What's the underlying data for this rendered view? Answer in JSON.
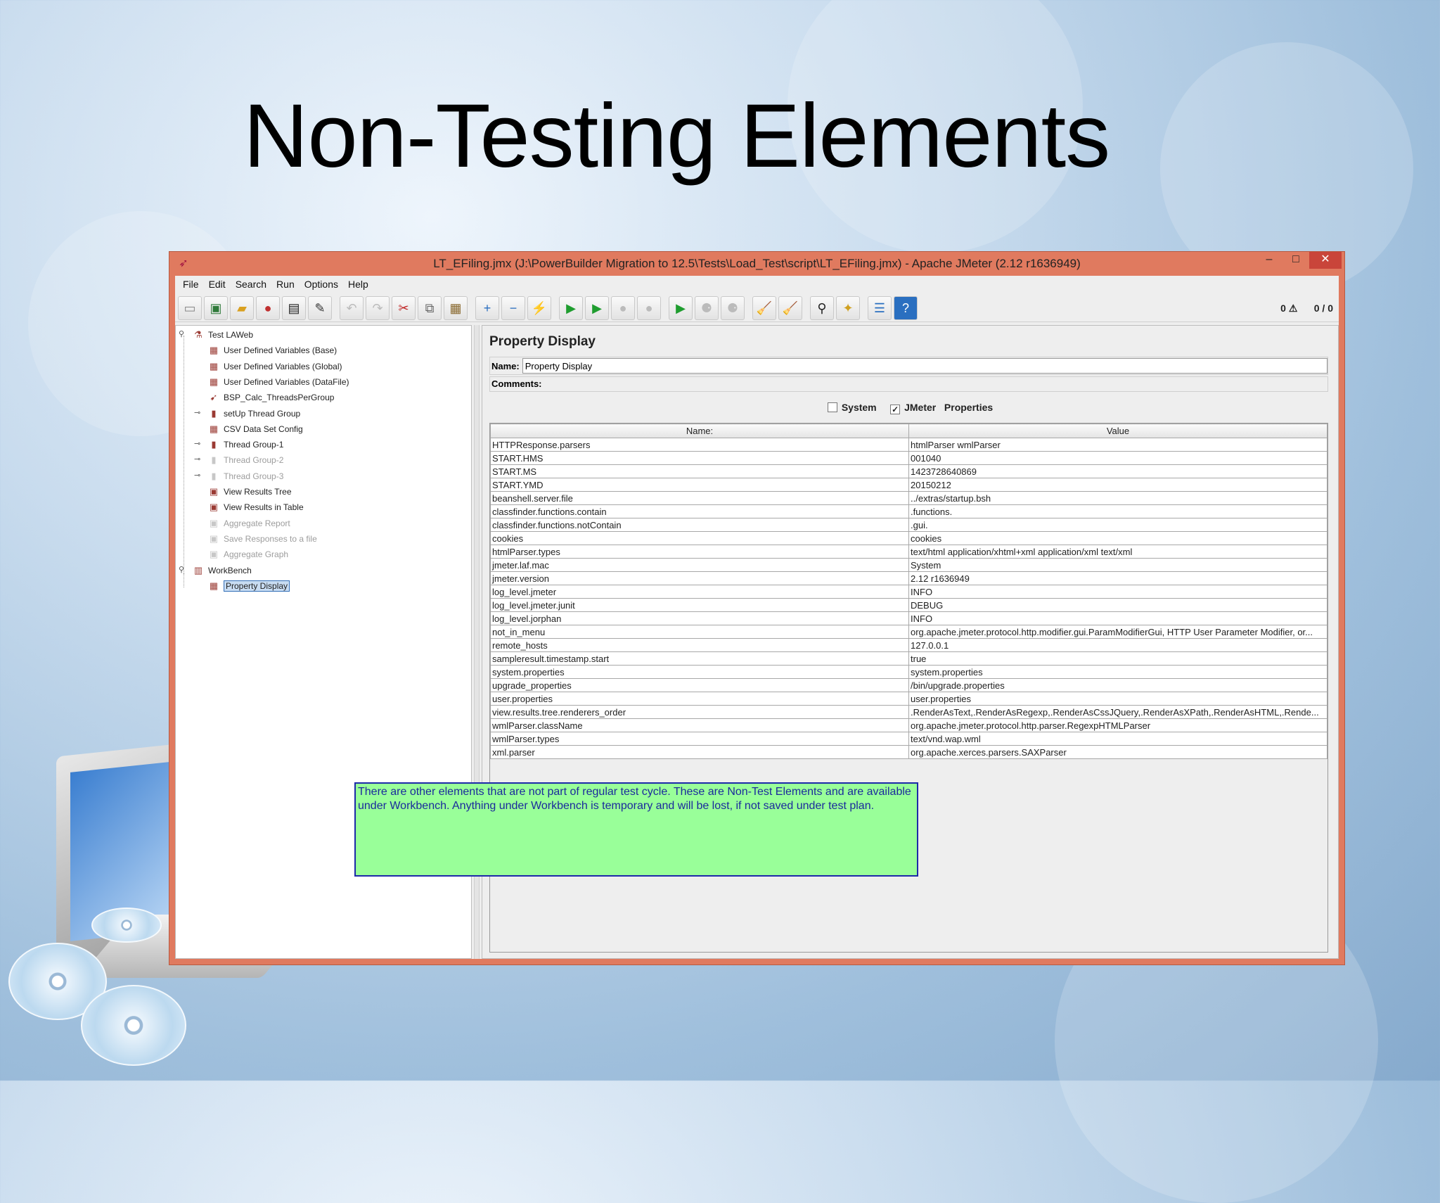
{
  "slide": {
    "title": "Non-Testing Elements",
    "note": "There are other elements that are not part of regular test cycle. These are Non-Test Elements and are available under Workbench. Anything under Workbench is temporary and will be lost, if not saved under test plan."
  },
  "window": {
    "title": "LT_EFiling.jmx (J:\\PowerBuilder Migration to 12.5\\Tests\\Load_Test\\script\\LT_EFiling.jmx) - Apache JMeter (2.12 r1636949)",
    "minimize": "–",
    "maximize": "□",
    "close": "✕"
  },
  "menu": [
    "File",
    "Edit",
    "Search",
    "Run",
    "Options",
    "Help"
  ],
  "toolbar": {
    "warnings": "0 ⚠",
    "threads": "0 / 0"
  },
  "tree": [
    {
      "label": "Test LAWeb",
      "level": 0,
      "icon": "flask-icon",
      "dim": false
    },
    {
      "label": "User Defined Variables (Base)",
      "level": 1,
      "icon": "config-icon",
      "dim": false
    },
    {
      "label": "User Defined Variables (Global)",
      "level": 1,
      "icon": "config-icon",
      "dim": false
    },
    {
      "label": "User Defined Variables (DataFile)",
      "level": 1,
      "icon": "config-icon",
      "dim": false
    },
    {
      "label": "BSP_Calc_ThreadsPerGroup",
      "level": 1,
      "icon": "script-icon",
      "dim": false
    },
    {
      "label": "setUp Thread Group",
      "level": 1,
      "icon": "thread-icon",
      "dim": false
    },
    {
      "label": "CSV Data Set Config",
      "level": 1,
      "icon": "config-icon",
      "dim": false
    },
    {
      "label": "Thread Group-1",
      "level": 1,
      "icon": "thread-icon",
      "dim": false
    },
    {
      "label": "Thread Group-2",
      "level": 1,
      "icon": "thread-icon",
      "dim": true
    },
    {
      "label": "Thread Group-3",
      "level": 1,
      "icon": "thread-icon",
      "dim": true
    },
    {
      "label": "View Results Tree",
      "level": 1,
      "icon": "listener-icon",
      "dim": false
    },
    {
      "label": "View Results in Table",
      "level": 1,
      "icon": "listener-icon",
      "dim": false
    },
    {
      "label": "Aggregate Report",
      "level": 1,
      "icon": "listener-icon",
      "dim": true
    },
    {
      "label": "Save Responses to a file",
      "level": 1,
      "icon": "listener-icon",
      "dim": true
    },
    {
      "label": "Aggregate Graph",
      "level": 1,
      "icon": "listener-icon",
      "dim": true
    },
    {
      "label": "WorkBench",
      "level": 0,
      "icon": "workbench-icon",
      "dim": false
    },
    {
      "label": "Property Display",
      "level": 1,
      "icon": "config-icon",
      "dim": false,
      "selected": true
    }
  ],
  "panel": {
    "title": "Property Display",
    "name_label": "Name:",
    "name_value": "Property Display",
    "comments_label": "Comments:",
    "system_label": "System",
    "system_checked": false,
    "jmeter_label": "JMeter",
    "jmeter_checked": true,
    "properties_label": "Properties",
    "columns": [
      "Name:",
      "Value"
    ],
    "rows": [
      [
        "HTTPResponse.parsers",
        "htmlParser wmlParser"
      ],
      [
        "START.HMS",
        "001040"
      ],
      [
        "START.MS",
        "1423728640869"
      ],
      [
        "START.YMD",
        "20150212"
      ],
      [
        "beanshell.server.file",
        "../extras/startup.bsh"
      ],
      [
        "classfinder.functions.contain",
        ".functions."
      ],
      [
        "classfinder.functions.notContain",
        ".gui."
      ],
      [
        "cookies",
        "cookies"
      ],
      [
        "htmlParser.types",
        "text/html application/xhtml+xml application/xml text/xml"
      ],
      [
        "jmeter.laf.mac",
        "System"
      ],
      [
        "jmeter.version",
        "2.12 r1636949"
      ],
      [
        "log_level.jmeter",
        "INFO"
      ],
      [
        "log_level.jmeter.junit",
        "DEBUG"
      ],
      [
        "log_level.jorphan",
        "INFO"
      ],
      [
        "not_in_menu",
        "org.apache.jmeter.protocol.http.modifier.gui.ParamModifierGui, HTTP User Parameter Modifier, or..."
      ],
      [
        "remote_hosts",
        "127.0.0.1"
      ],
      [
        "sampleresult.timestamp.start",
        "true"
      ],
      [
        "system.properties",
        "system.properties"
      ],
      [
        "upgrade_properties",
        "/bin/upgrade.properties"
      ],
      [
        "user.properties",
        "user.properties"
      ],
      [
        "view.results.tree.renderers_order",
        ".RenderAsText,.RenderAsRegexp,.RenderAsCssJQuery,.RenderAsXPath,.RenderAsHTML,.Rende..."
      ],
      [
        "wmlParser.className",
        "org.apache.jmeter.protocol.http.parser.RegexpHTMLParser"
      ],
      [
        "wmlParser.types",
        "text/vnd.wap.wml"
      ],
      [
        "xml.parser",
        "org.apache.xerces.parsers.SAXParser"
      ]
    ]
  }
}
